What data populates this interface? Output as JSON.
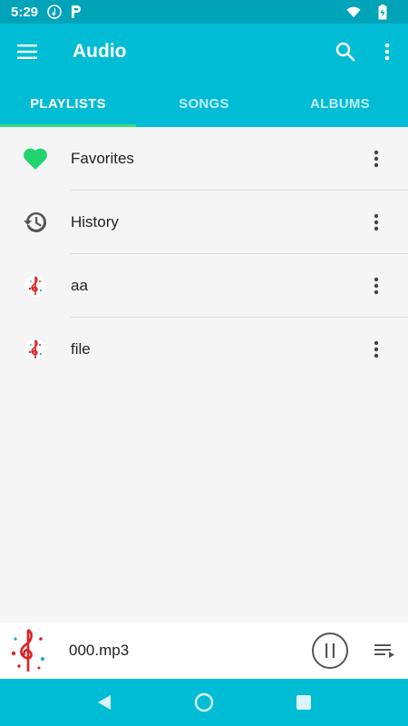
{
  "status_bar": {
    "time": "5:29",
    "icons": [
      "music-note-icon",
      "parking-p-icon",
      "wifi-icon",
      "battery-charging-icon"
    ]
  },
  "app_bar": {
    "title": "Audio",
    "icons": [
      "menu-icon",
      "search-icon",
      "overflow-menu-icon"
    ]
  },
  "tabs": [
    {
      "label": "PLAYLISTS",
      "active": true
    },
    {
      "label": "SONGS",
      "active": false
    },
    {
      "label": "ALBUMS",
      "active": false
    }
  ],
  "playlists": [
    {
      "label": "Favorites",
      "icon": "heart-icon"
    },
    {
      "label": "History",
      "icon": "history-icon"
    },
    {
      "label": "aa",
      "icon": "music-art-icon"
    },
    {
      "label": "file",
      "icon": "music-art-icon"
    }
  ],
  "player": {
    "track": "000.mp3",
    "icons": [
      "album-art-icon",
      "pause-icon",
      "queue-icon"
    ]
  },
  "nav_bar": {
    "icons": [
      "back-icon",
      "home-icon",
      "recents-icon"
    ]
  },
  "colors": {
    "primary": "#00bcd4",
    "status_bar": "#00a3b8",
    "accent": "#3ddc84",
    "heart": "#22d36e"
  }
}
